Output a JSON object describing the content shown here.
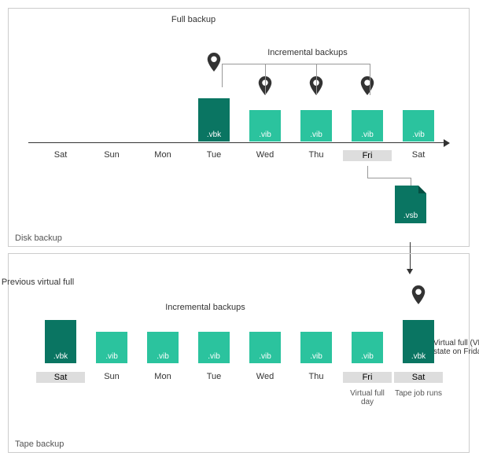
{
  "ext": {
    "full": ".vbk",
    "inc": ".vib",
    "vsb": ".vsb"
  },
  "labels": {
    "disk_panel": "Disk backup",
    "tape_panel": "Tape backup",
    "full_backup": "Full backup",
    "incremental": "Incremental backups",
    "prev_virtual": "Previous virtual full",
    "virtual_full_day": "Virtual full day",
    "tape_job_runs": "Tape job runs",
    "virtual_full_side": "Virtual full (VMs state on Friday)"
  },
  "disk_days": [
    "Sat",
    "Sun",
    "Mon",
    "Tue",
    "Wed",
    "Thu",
    "Fri",
    "Sat"
  ],
  "tape_days": [
    "Sat",
    "Sun",
    "Mon",
    "Tue",
    "Wed",
    "Thu",
    "Fri",
    "Sat"
  ],
  "chart_data": {
    "type": "diagram",
    "disk": [
      {
        "day": "Sat",
        "bar": null
      },
      {
        "day": "Sun",
        "bar": null
      },
      {
        "day": "Mon",
        "bar": null
      },
      {
        "day": "Tue",
        "bar": "full",
        "pin": true
      },
      {
        "day": "Wed",
        "bar": "inc",
        "pin": true
      },
      {
        "day": "Thu",
        "bar": "inc",
        "pin": true
      },
      {
        "day": "Fri",
        "bar": "inc",
        "pin": true,
        "highlight": true,
        "vsb_below": true
      },
      {
        "day": "Sat",
        "bar": "inc"
      }
    ],
    "tape": [
      {
        "day": "Sat",
        "bar": "full",
        "highlight": true
      },
      {
        "day": "Sun",
        "bar": "inc"
      },
      {
        "day": "Mon",
        "bar": "inc"
      },
      {
        "day": "Tue",
        "bar": "inc"
      },
      {
        "day": "Wed",
        "bar": "inc"
      },
      {
        "day": "Thu",
        "bar": "inc"
      },
      {
        "day": "Fri",
        "bar": "inc",
        "highlight": true,
        "sub": "virtual_full_day"
      },
      {
        "day": "Sat",
        "bar": "full",
        "pin": true,
        "highlight": true,
        "sub": "tape_job_runs"
      }
    ]
  }
}
